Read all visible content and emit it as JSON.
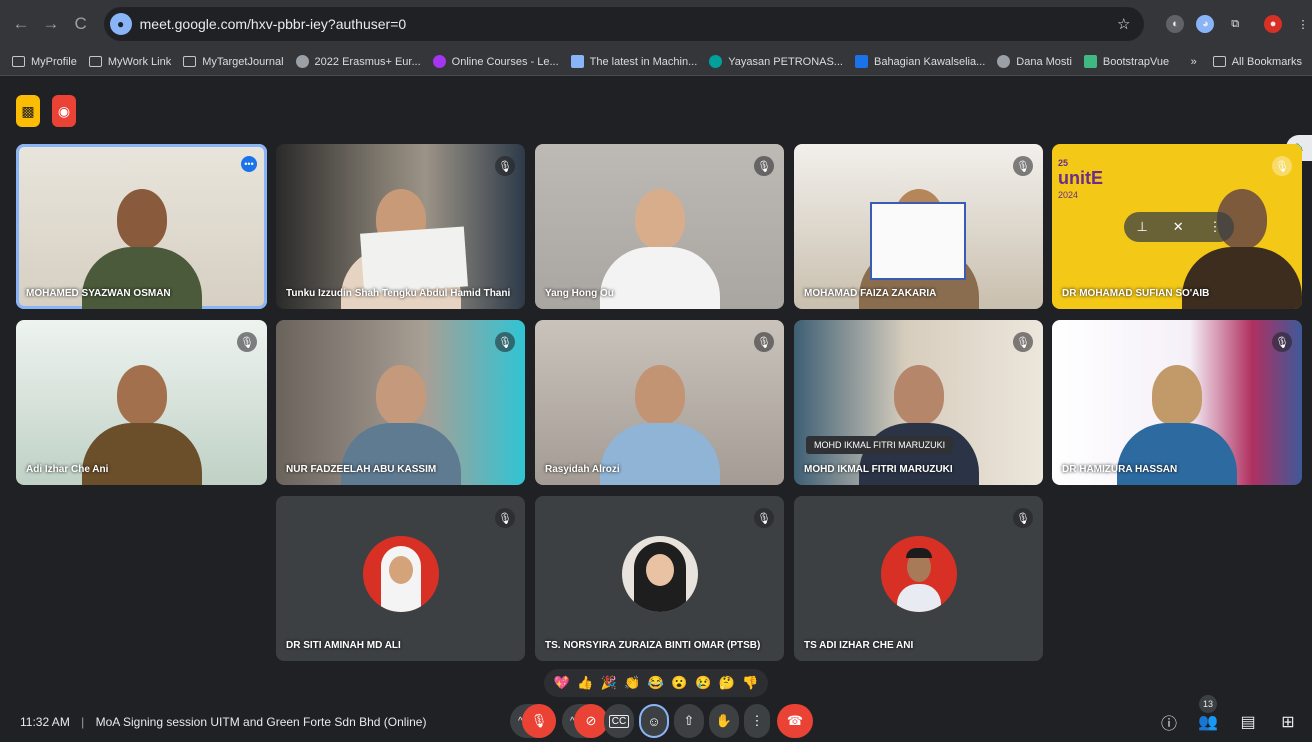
{
  "browser": {
    "url": "meet.google.com/hxv-pbbr-iey?authuser=0",
    "nav_back": "←",
    "nav_forward": "→",
    "nav_reload": "C",
    "star": "☆",
    "menu": "⋮",
    "bookmarks": [
      {
        "label": "MyProfile",
        "icon": "folder-icon"
      },
      {
        "label": "MyWork Link",
        "icon": "folder-icon"
      },
      {
        "label": "MyTargetJournal",
        "icon": "folder-icon"
      },
      {
        "label": "2022 Erasmus+ Eur...",
        "icon": "globe-icon"
      },
      {
        "label": "Online Courses - Le...",
        "icon": "udemy-icon"
      },
      {
        "label": "The latest in Machin...",
        "icon": "paperswithcode-icon"
      },
      {
        "label": "Yayasan PETRONAS...",
        "icon": "petronas-icon"
      },
      {
        "label": "Bahagian Kawalselia...",
        "icon": "site-icon"
      },
      {
        "label": "Dana Mosti",
        "icon": "globe-icon"
      },
      {
        "label": "BootstrapVue",
        "icon": "bootstrapvue-icon"
      }
    ],
    "more_bookmarks": "»",
    "all_bookmarks": "All Bookmarks"
  },
  "participants": [
    {
      "name": "MOHAMED SYAZWAN OSMAN",
      "type": "video"
    },
    {
      "name": "Tunku Izzudin Shah Tengku Abdul Hamid Thani",
      "type": "video"
    },
    {
      "name": "Yang Hong Ou",
      "type": "video"
    },
    {
      "name": "MOHAMAD FAIZA ZAKARIA",
      "type": "video"
    },
    {
      "name": "DR MOHAMAD SUFIAN SO'AIB",
      "type": "video"
    },
    {
      "name": "Adi Izhar Che Ani",
      "type": "video"
    },
    {
      "name": "NUR FADZEELAH ABU KASSIM",
      "type": "video"
    },
    {
      "name": "Rasyidah Alrozi",
      "type": "video"
    },
    {
      "name": "MOHD IKMAL FITRI MARUZUKI",
      "type": "video",
      "label": "MOHD IKMAL FITRI MARUZUKI"
    },
    {
      "name": "DR HAMIZURA HASSAN",
      "type": "video"
    },
    {
      "name": "DR SITI AMINAH MD ALI",
      "type": "avatar"
    },
    {
      "name": "TS. NORSYIRA ZURAIZA BINTI OMAR (PTSB)",
      "type": "avatar"
    },
    {
      "name": "TS ADI IZHAR CHE ANI",
      "type": "avatar"
    }
  ],
  "tile_text": {
    "unite": "unitE",
    "unite_year": "2024",
    "unite_num": "25"
  },
  "reactions": [
    "💖",
    "👍",
    "🎉",
    "👏",
    "😂",
    "😮",
    "😢",
    "🤔",
    "👎"
  ],
  "bottom": {
    "time": "11:32 AM",
    "separator": "|",
    "meeting_title": "MoA Signing session UITM and Green Forte Sdn Bhd (Online)",
    "people_count": "13"
  },
  "colors": {
    "accent_blue": "#8ab4f8",
    "end_red": "#ea4335",
    "host_yellow": "#fbbc04"
  }
}
